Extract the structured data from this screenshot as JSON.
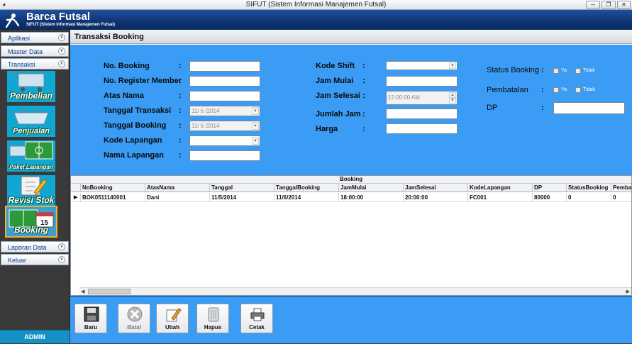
{
  "window": {
    "title": "SIFUT (Sistem Informasi Manajemen Futsal)"
  },
  "header": {
    "app_name": "Barca Futsal",
    "subtitle": "SIFUT (Sistem Informasi Manajemen Futsal)"
  },
  "sidebar": {
    "sections": [
      {
        "label": "Aplikasi"
      },
      {
        "label": "Master Data"
      },
      {
        "label": "Transaksi"
      },
      {
        "label": "Laporan Data"
      },
      {
        "label": "Keluar"
      }
    ],
    "tiles": [
      {
        "label": "Pembelian"
      },
      {
        "label": "Penjualan"
      },
      {
        "label": "Paket Lapangan"
      },
      {
        "label": "Revisi Stok"
      },
      {
        "label": "Booking"
      }
    ],
    "footer": "ADMIN"
  },
  "page": {
    "title": "Transaksi Booking"
  },
  "form": {
    "no_booking": "No. Booking",
    "no_register_member": "No. Register Member",
    "atas_nama": "Atas Nama",
    "tanggal_transaksi": "Tanggal Transaksi",
    "tanggal_transaksi_value": "11/ 6 /2014",
    "tanggal_booking": "Tanggal Booking",
    "tanggal_booking_value": "11/ 6 /2014",
    "kode_lapangan": "Kode Lapangan",
    "nama_lapangan": "Nama Lapangan",
    "kode_shift": "Kode Shift",
    "jam_mulai": "Jam Mulai",
    "jam_selesai": "Jam Selesai",
    "jam_selesai_value": "12:00:00 AM",
    "jumlah_jam": "Jumlah Jam",
    "harga": "Harga",
    "status_booking": "Status Booking",
    "pembatalan": "Pembatalan",
    "dp": "DP",
    "ya": "Ya",
    "tidak": "Tidak",
    "colon": ":"
  },
  "grid": {
    "caption": "Booking",
    "columns": [
      "NoBooking",
      "AtasNama",
      "Tanggal",
      "TanggalBooking",
      "JamMulai",
      "JamSelesai",
      "KodeLapangan",
      "DP",
      "StatusBooking",
      "Pemba"
    ],
    "rows": [
      [
        "BOK0511140001",
        "Dani",
        "11/5/2014",
        "11/6/2014",
        "18:00:00",
        "20:00:00",
        "FC001",
        "80000",
        "0",
        "0"
      ]
    ]
  },
  "toolbar": {
    "baru": "Baru",
    "batal": "Batal",
    "ubah": "Ubah",
    "hapus": "Hapus",
    "cetak": "Cetak"
  }
}
